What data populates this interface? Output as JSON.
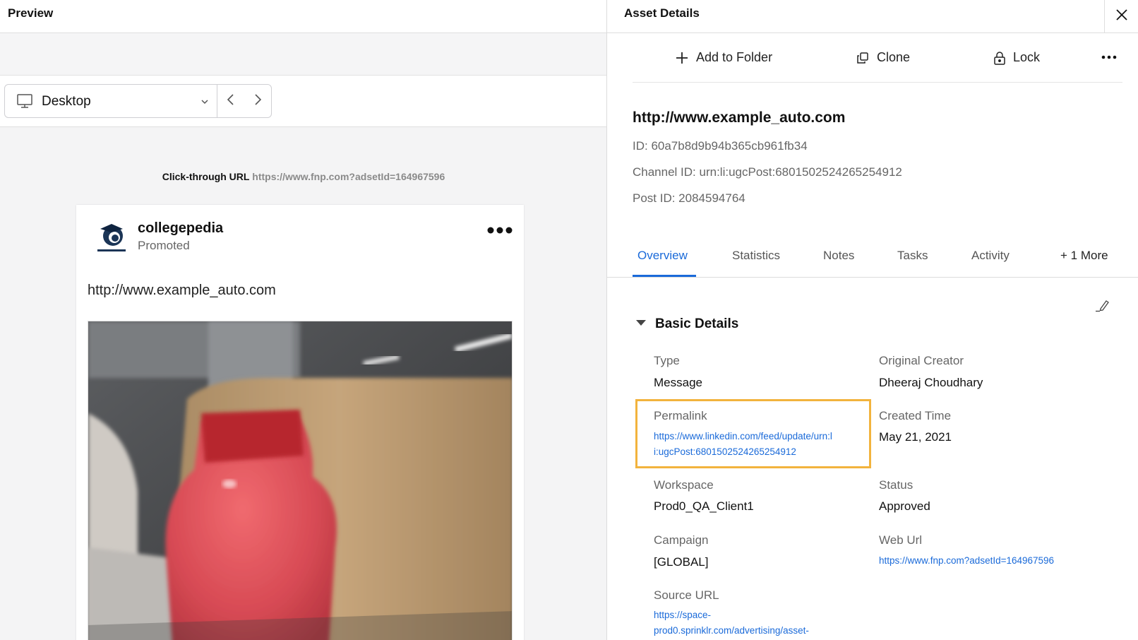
{
  "preview": {
    "title": "Preview",
    "device": "Desktop",
    "click_through_label": "Click-through URL",
    "click_through_url": "https://www.fnp.com?adsetId=164967596",
    "post": {
      "author": "collegepedia",
      "sponsor": "Promoted",
      "text": "http://www.example_auto.com"
    }
  },
  "details": {
    "title": "Asset Details",
    "actions": {
      "add_to_folder": "Add to Folder",
      "clone": "Clone",
      "lock": "Lock"
    },
    "asset_name": "http://www.example_auto.com",
    "id_line": "ID: 60a7b8d9b94b365cb961fb34",
    "channel_id_line": "Channel ID: urn:li:ugcPost:6801502524265254912",
    "post_id_line": "Post ID: 2084594764",
    "tabs": [
      "Overview",
      "Statistics",
      "Notes",
      "Tasks",
      "Activity",
      "+ 1 More"
    ],
    "section_title": "Basic Details",
    "fields": {
      "type_label": "Type",
      "type_value": "Message",
      "creator_label": "Original Creator",
      "creator_value": "Dheeraj Choudhary",
      "permalink_label": "Permalink",
      "permalink_line1": "https://www.linkedin.com/feed/update/urn:l",
      "permalink_line2": "i:ugcPost:6801502524265254912",
      "created_label": "Created Time",
      "created_value": "May 21, 2021",
      "workspace_label": "Workspace",
      "workspace_value": "Prod0_QA_Client1",
      "status_label": "Status",
      "status_value": "Approved",
      "campaign_label": "Campaign",
      "campaign_value": "[GLOBAL]",
      "weburl_label": "Web Url",
      "weburl_value": "https://www.fnp.com?adsetId=164967596",
      "source_label": "Source URL",
      "source_line1": "https://space-",
      "source_line2": "prod0.sprinklr.com/advertising/asset-"
    }
  },
  "colors": {
    "accent": "#1a6ad9",
    "highlight": "#f2b33d"
  },
  "icons": [
    "monitor-icon",
    "chevron-down-icon",
    "chevron-left-icon",
    "chevron-right-icon",
    "more-horizontal-icon",
    "plus-icon",
    "clone-icon",
    "lock-icon",
    "close-icon",
    "triangle-down-icon",
    "pencil-icon"
  ]
}
